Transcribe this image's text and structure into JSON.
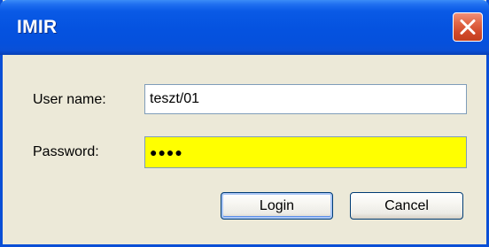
{
  "window": {
    "title": "IMIR"
  },
  "form": {
    "username_label": "User name:",
    "username_value": "teszt/01",
    "password_label": "Password:",
    "password_value": "●●●●"
  },
  "buttons": {
    "login_label": "Login",
    "cancel_label": "Cancel"
  },
  "icons": {
    "close": "close-icon"
  },
  "colors": {
    "titlebar": "#0553e0",
    "close_button": "#d1492a",
    "password_highlight": "#ffff00",
    "dialog_background": "#ece9d8"
  }
}
